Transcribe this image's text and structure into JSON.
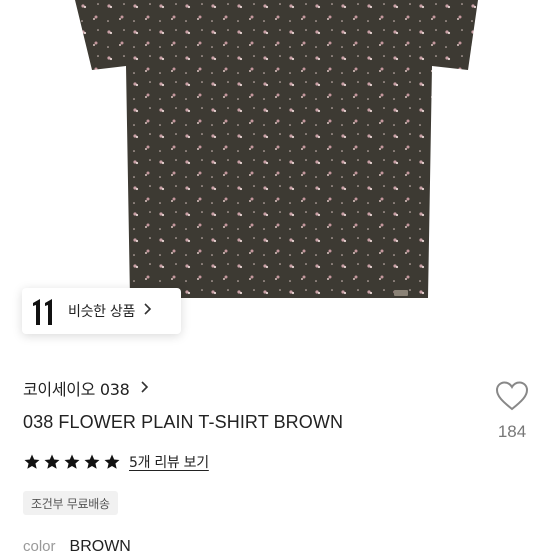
{
  "similar_button": {
    "label": "비슷한 상품"
  },
  "product": {
    "brand": "코이세이오 038",
    "name": "038 FLOWER PLAIN T-SHIRT BROWN",
    "like_count": "184",
    "rating": 5,
    "rating_max": 5,
    "review_link": "5개 리뷰 보기",
    "shipping_badge": "조건부 무료배송",
    "color_label": "color",
    "color_value": "BROWN"
  },
  "colors": {
    "shirt": "#3d3a33",
    "star": "#111111",
    "heart_outline": "#888888"
  },
  "icons": [
    "chevron-right-icon",
    "heart-icon",
    "star-icon",
    "logo-icon"
  ]
}
